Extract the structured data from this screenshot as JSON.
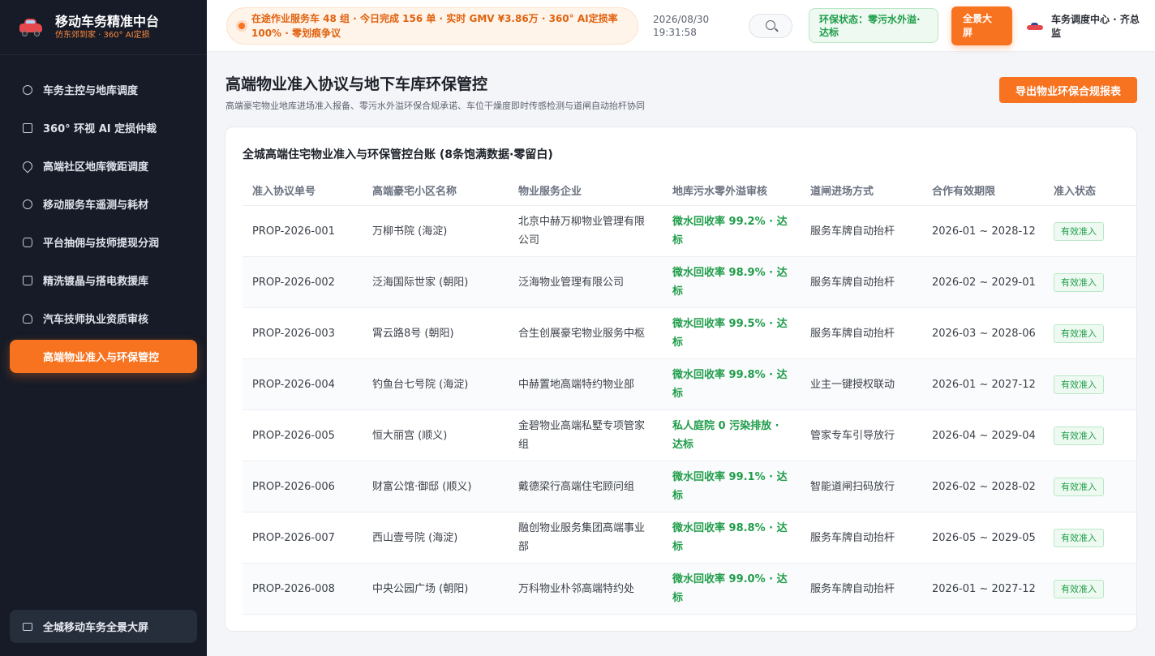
{
  "brand": {
    "title": "移动车务精准中台",
    "subtitle": "仿东郊到家 · 360° AI定损"
  },
  "sidebar": {
    "items": [
      {
        "label": "车务主控与地库调度",
        "icon": "dashboard-icon"
      },
      {
        "label": "360° 环视 AI 定损仲裁",
        "icon": "camera-icon"
      },
      {
        "label": "高端社区地库微距调度",
        "icon": "location-pin-icon"
      },
      {
        "label": "移动服务车遥测与耗材",
        "icon": "gear-icon"
      },
      {
        "label": "平台抽佣与技师提现分润",
        "icon": "database-icon"
      },
      {
        "label": "精洗镀晶与搭电救援库",
        "icon": "bag-icon"
      },
      {
        "label": "汽车技师执业资质审核",
        "icon": "user-icon"
      },
      {
        "label": "高端物业准入与环保管控",
        "icon": "",
        "active": true
      }
    ],
    "bottom_button": "全城移动车务全景大屏"
  },
  "topbar": {
    "ticker": "在途作业服务车 48 组 · 今日完成 156 单 · 实时 GMV ¥3.86万 · 360° AI定损率 100% · 零划痕争议",
    "date": "2026/08/30",
    "time": "19:31:58",
    "eco_status": "环保状态：零污水外溢·达标",
    "fullscreen_label": "全景大屏",
    "user_name": "车务调度中心 · 齐总监"
  },
  "page": {
    "title": "高端物业准入协议与地下车库环保管控",
    "subtitle": "高端豪宅物业地库进场准入报备、零污水外溢环保合规承诺、车位干燥度即时传感检测与道闸自动抬杆协同",
    "export_label": "导出物业环保合规报表"
  },
  "table": {
    "title": "全城高端住宅物业准入与环保管控台账 (8条饱满数据·零留白)",
    "headers": [
      "准入协议单号",
      "高端豪宅小区名称",
      "物业服务企业",
      "地库污水零外溢审核",
      "道闸进场方式",
      "合作有效期限",
      "准入状态"
    ],
    "rows": [
      [
        "PROP-2026-001",
        "万柳书院 (海淀)",
        "北京中赫万柳物业管理有限公司",
        "微水回收率 99.2% · 达标",
        "服务车牌自动抬杆",
        "2026-01 ~ 2028-12",
        "有效准入"
      ],
      [
        "PROP-2026-002",
        "泛海国际世家 (朝阳)",
        "泛海物业管理有限公司",
        "微水回收率 98.9% · 达标",
        "服务车牌自动抬杆",
        "2026-02 ~ 2029-01",
        "有效准入"
      ],
      [
        "PROP-2026-003",
        "霄云路8号 (朝阳)",
        "合生创展豪宅物业服务中枢",
        "微水回收率 99.5% · 达标",
        "服务车牌自动抬杆",
        "2026-03 ~ 2028-06",
        "有效准入"
      ],
      [
        "PROP-2026-004",
        "钓鱼台七号院 (海淀)",
        "中赫置地高端特约物业部",
        "微水回收率 99.8% · 达标",
        "业主一键授权联动",
        "2026-01 ~ 2027-12",
        "有效准入"
      ],
      [
        "PROP-2026-005",
        "恒大丽宫 (顺义)",
        "金碧物业高端私墅专项管家组",
        "私人庭院 0 污染排放 · 达标",
        "管家专车引导放行",
        "2026-04 ~ 2029-04",
        "有效准入"
      ],
      [
        "PROP-2026-006",
        "财富公馆·御邸 (顺义)",
        "戴德梁行高端住宅顾问组",
        "微水回收率 99.1% · 达标",
        "智能道闸扫码放行",
        "2026-02 ~ 2028-02",
        "有效准入"
      ],
      [
        "PROP-2026-007",
        "西山壹号院 (海淀)",
        "融创物业服务集团高端事业部",
        "微水回收率 98.8% · 达标",
        "服务车牌自动抬杆",
        "2026-05 ~ 2029-05",
        "有效准入"
      ],
      [
        "PROP-2026-008",
        "中央公园广场 (朝阳)",
        "万科物业朴邻高端特约处",
        "微水回收率 99.0% · 达标",
        "服务车牌自动抬杆",
        "2026-01 ~ 2027-12",
        "有效准入"
      ]
    ]
  },
  "colors": {
    "accent": "#f7731f",
    "sidebar_bg": "#161b27",
    "success": "#1f9d4a"
  }
}
